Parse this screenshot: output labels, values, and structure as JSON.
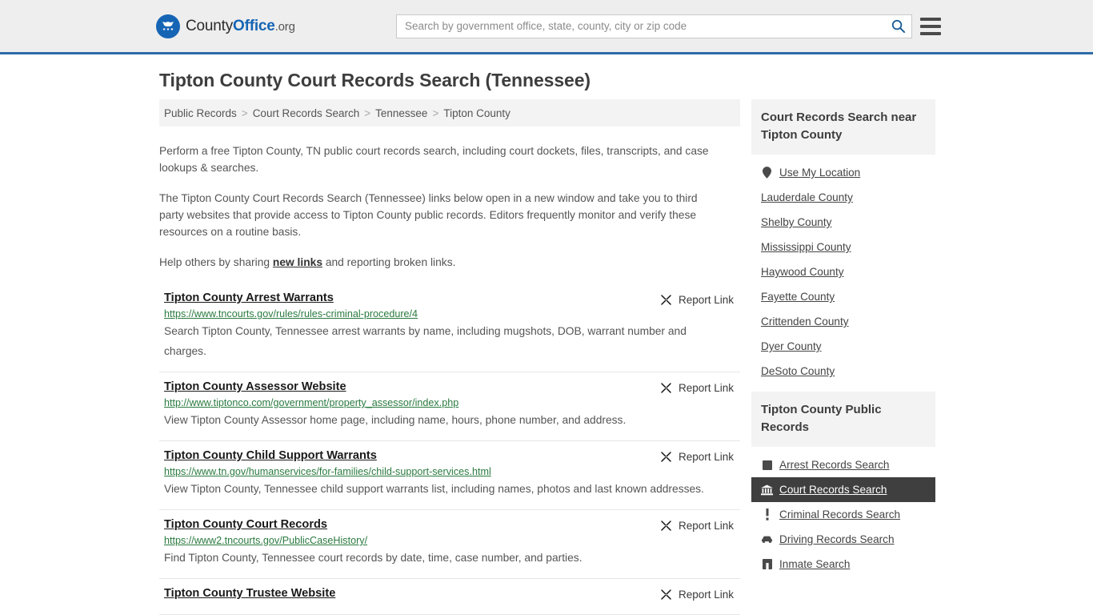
{
  "header": {
    "logo": {
      "part1": "County",
      "part2": "Office",
      "part3": ".org",
      "icon": "eagle-seal-icon"
    },
    "search": {
      "placeholder": "Search by government office, state, county, city or zip code",
      "value": "",
      "button_icon": "search-icon"
    },
    "menu_icon": "hamburger-menu-icon",
    "accent_color": "#2d6ca8",
    "bg_color": "#eeeeee"
  },
  "page": {
    "title": "Tipton County Court Records Search (Tennessee)"
  },
  "breadcrumb": {
    "separator": ">",
    "items": [
      {
        "label": "Public Records"
      },
      {
        "label": "Court Records Search"
      },
      {
        "label": "Tennessee"
      },
      {
        "label": "Tipton County"
      }
    ]
  },
  "intro": {
    "p1": "Perform a free Tipton County, TN public court records search, including court dockets, files, transcripts, and case lookups & searches.",
    "p2": "The Tipton County Court Records Search (Tennessee) links below open in a new window and take you to third party websites that provide access to Tipton County public records. Editors frequently monitor and verify these resources on a routine basis.",
    "p3_before": "Help others by sharing ",
    "p3_link": "new links",
    "p3_after": " and reporting broken links."
  },
  "report_link_label": "Report Link",
  "report_link_icon": "broken-link-icon",
  "results": [
    {
      "title": "Tipton County Arrest Warrants",
      "url": "https://www.tncourts.gov/rules/rules-criminal-procedure/4",
      "description": "Search Tipton County, Tennessee arrest warrants by name, including mugshots, DOB, warrant number and charges."
    },
    {
      "title": " Tipton County Assessor Website",
      "url": "http://www.tiptonco.com/government/property_assessor/index.php",
      "description": "View Tipton County Assessor home page, including name, hours, phone number, and address."
    },
    {
      "title": "Tipton County Child Support Warrants",
      "url": "https://www.tn.gov/humanservices/for-families/child-support-services.html",
      "description": "View Tipton County, Tennessee child support warrants list, including names, photos and last known addresses."
    },
    {
      "title": "Tipton County Court Records",
      "url": "https://www2.tncourts.gov/PublicCaseHistory/",
      "description": "Find Tipton County, Tennessee court records by date, time, case number, and parties."
    },
    {
      "title": "Tipton County Trustee Website",
      "url": "",
      "description": ""
    }
  ],
  "sidebar": {
    "nearby": {
      "heading": "Court Records Search near Tipton County",
      "items": [
        {
          "label": "Use My Location",
          "icon": "map-pin-icon"
        },
        {
          "label": "Lauderdale County",
          "icon": ""
        },
        {
          "label": "Shelby County",
          "icon": ""
        },
        {
          "label": "Mississippi County",
          "icon": ""
        },
        {
          "label": "Haywood County",
          "icon": ""
        },
        {
          "label": "Fayette County",
          "icon": ""
        },
        {
          "label": "Crittenden County",
          "icon": ""
        },
        {
          "label": "Dyer County",
          "icon": ""
        },
        {
          "label": "DeSoto County",
          "icon": ""
        }
      ]
    },
    "public_records": {
      "heading": "Tipton County Public Records",
      "items": [
        {
          "label": "Arrest Records Search",
          "icon": "square-icon",
          "active": false
        },
        {
          "label": "Court Records Search",
          "icon": "courthouse-icon",
          "active": true
        },
        {
          "label": "Criminal Records Search",
          "icon": "exclamation-icon",
          "active": false
        },
        {
          "label": "Driving Records Search",
          "icon": "car-icon",
          "active": false
        },
        {
          "label": "Inmate Search",
          "icon": "building-icon",
          "active": false
        }
      ]
    }
  }
}
